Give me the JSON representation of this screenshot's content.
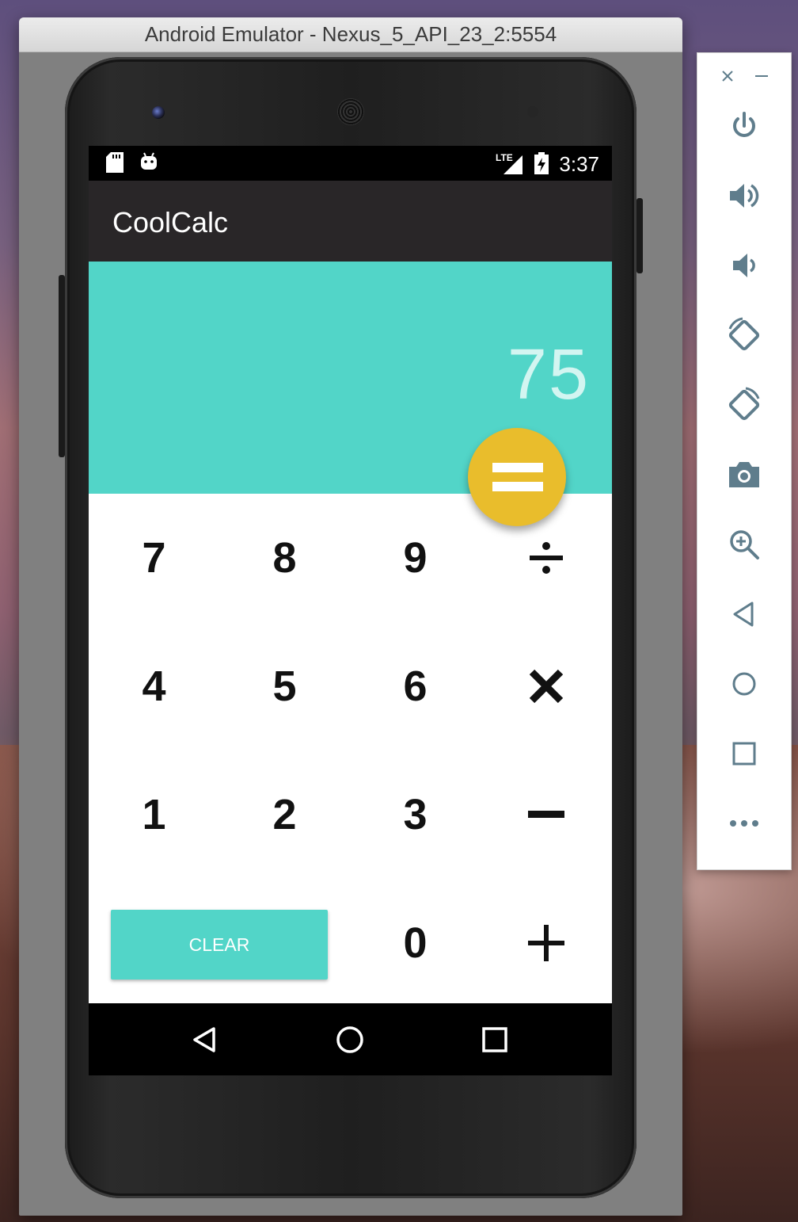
{
  "window": {
    "title": "Android Emulator - Nexus_5_API_23_2:5554"
  },
  "status_bar": {
    "time": "3:37",
    "network": "LTE",
    "icons": [
      "sd-card-icon",
      "android-icon",
      "lte-signal-icon",
      "battery-icon"
    ]
  },
  "app_bar": {
    "title": "CoolCalc"
  },
  "display": {
    "value": "75"
  },
  "keypad": {
    "row1": [
      "7",
      "8",
      "9"
    ],
    "row2": [
      "4",
      "5",
      "6"
    ],
    "row3": [
      "1",
      "2",
      "3"
    ],
    "zero": "0",
    "clear_label": "CLEAR",
    "operators": [
      "divide-icon",
      "multiply-icon",
      "minus-icon",
      "plus-icon"
    ]
  },
  "equals_button": {
    "icon": "equals-icon"
  },
  "nav_bar": {
    "icons": [
      "back-icon",
      "home-icon",
      "recents-icon"
    ]
  },
  "emulator_toolbar": {
    "icons": [
      "close-icon",
      "minimize-icon",
      "power-icon",
      "volume-up-icon",
      "volume-down-icon",
      "rotate-left-icon",
      "rotate-right-icon",
      "camera-icon",
      "zoom-icon",
      "back-icon",
      "home-icon",
      "overview-icon",
      "more-icon"
    ]
  },
  "colors": {
    "accent_teal": "#52d5c8",
    "fab_yellow": "#e9bd2c",
    "app_bar": "#292628",
    "display_text": "#d3f5f1",
    "toolbar_icon": "#5f7d8c"
  }
}
